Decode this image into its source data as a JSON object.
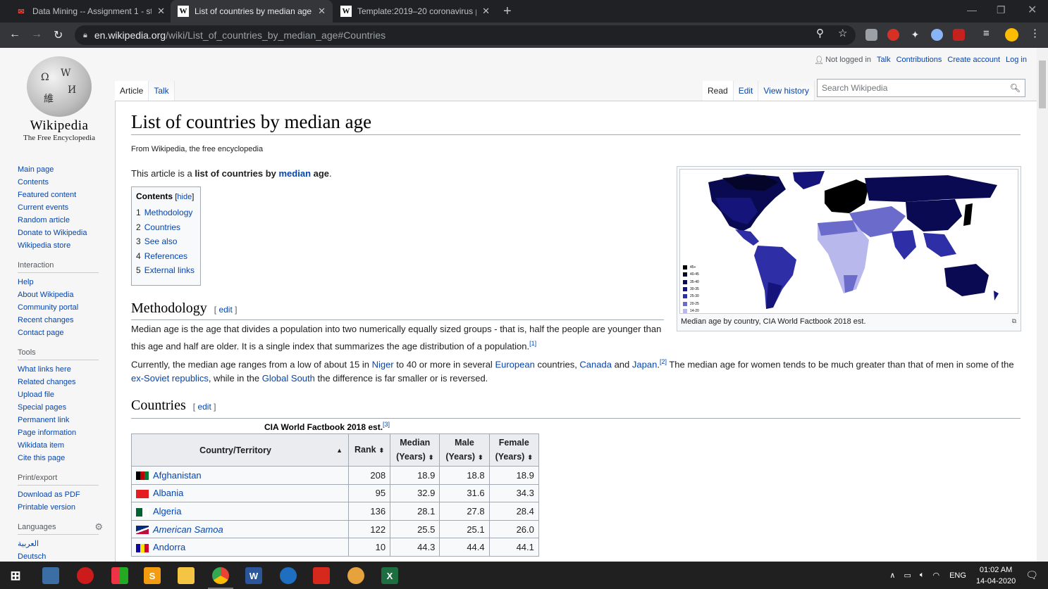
{
  "browser": {
    "tabs": [
      {
        "title": "Data Mining -- Assignment 1 - st",
        "icon": "gmail-icon",
        "active": false
      },
      {
        "title": "List of countries by median age -",
        "icon": "wikipedia-icon",
        "active": true
      },
      {
        "title": "Template:2019–20 coronavirus p",
        "icon": "wikipedia-icon",
        "active": false
      }
    ],
    "url_host": "en.wikipedia.org",
    "url_path": "/wiki/List_of_countries_by_median_age#Countries"
  },
  "wiki": {
    "logo_wordmark": "Wikipedia",
    "logo_tagline": "The Free Encyclopedia",
    "personal": {
      "not_logged_in": "Not logged in",
      "talk": "Talk",
      "contributions": "Contributions",
      "create_account": "Create account",
      "log_in": "Log in"
    },
    "tabs": {
      "article": "Article",
      "talk": "Talk",
      "read": "Read",
      "edit": "Edit",
      "history": "View history"
    },
    "search_placeholder": "Search Wikipedia",
    "sidebar": {
      "navigation": [
        "Main page",
        "Contents",
        "Featured content",
        "Current events",
        "Random article",
        "Donate to Wikipedia",
        "Wikipedia store"
      ],
      "interaction_heading": "Interaction",
      "interaction": [
        "Help",
        "About Wikipedia",
        "Community portal",
        "Recent changes",
        "Contact page"
      ],
      "tools_heading": "Tools",
      "tools": [
        "What links here",
        "Related changes",
        "Upload file",
        "Special pages",
        "Permanent link",
        "Page information",
        "Wikidata item",
        "Cite this page"
      ],
      "print_heading": "Print/export",
      "print": [
        "Download as PDF",
        "Printable version"
      ],
      "languages_heading": "Languages",
      "languages": [
        "العربية",
        "Deutsch"
      ]
    },
    "title": "List of countries by median age",
    "site_sub": "From Wikipedia, the free encyclopedia",
    "intro": {
      "pre": "This article is a ",
      "bold1": "list of countries by ",
      "link": "median",
      "bold2": " age",
      "post": "."
    },
    "toc": {
      "title": "Contents",
      "hide": "hide",
      "items": [
        {
          "num": "1",
          "label": "Methodology"
        },
        {
          "num": "2",
          "label": "Countries"
        },
        {
          "num": "3",
          "label": "See also"
        },
        {
          "num": "4",
          "label": "References"
        },
        {
          "num": "5",
          "label": "External links"
        }
      ]
    },
    "methodology": {
      "heading": "Methodology",
      "edit": "edit",
      "p1a": "Median age is the age that divides a population into two numerically equally sized groups - that is, half the people are younger than",
      "p1b": "this age and half are older. It is a single index that summarizes the age distribution of a population.",
      "p1_ref": "[1]",
      "p2": {
        "t1": "Currently, the median age ranges from a low of about 15 in ",
        "l1": "Niger",
        "t2": " to 40 or more in several ",
        "l2": "European",
        "t3": " countries, ",
        "l3": "Canada",
        "t4": " and ",
        "l4": "Japan",
        "t5": ".",
        "ref": "[2]",
        "t6": " The median age for women tends to be much greater than that of men in some of the",
        "l5": "ex-Soviet republics",
        "t7": ", while in the ",
        "l6": "Global South",
        "t8": " the difference is far smaller or is reversed."
      }
    },
    "map": {
      "caption": "Median age by country, CIA World Factbook 2018 est.",
      "legend": [
        {
          "label": "45+",
          "color": "#000000"
        },
        {
          "label": "40-45",
          "color": "#050529"
        },
        {
          "label": "35-40",
          "color": "#0a0a52"
        },
        {
          "label": "30-35",
          "color": "#14147a"
        },
        {
          "label": "25-30",
          "color": "#2e2ea6"
        },
        {
          "label": "20-25",
          "color": "#6b6bcc"
        },
        {
          "label": "14-20",
          "color": "#b8b8ec"
        }
      ]
    },
    "countries": {
      "heading": "Countries",
      "edit": "edit",
      "caption": "CIA World Factbook 2018 est.",
      "caption_ref": "[3]",
      "headers": {
        "country": "Country/Territory",
        "rank": "Rank",
        "median1": "Median",
        "median2": "(Years)",
        "male1": "Male",
        "male2": "(Years)",
        "female1": "Female",
        "female2": "(Years)"
      },
      "rows": [
        {
          "country": "Afghanistan",
          "rank": "208",
          "median": "18.9",
          "male": "18.8",
          "female": "18.9",
          "italic": false
        },
        {
          "country": "Albania",
          "rank": "95",
          "median": "32.9",
          "male": "31.6",
          "female": "34.3",
          "italic": false
        },
        {
          "country": "Algeria",
          "rank": "136",
          "median": "28.1",
          "male": "27.8",
          "female": "28.4",
          "italic": false
        },
        {
          "country": "American Samoa",
          "rank": "122",
          "median": "25.5",
          "male": "25.1",
          "female": "26.0",
          "italic": true
        },
        {
          "country": "Andorra",
          "rank": "10",
          "median": "44.3",
          "male": "44.4",
          "female": "44.1",
          "italic": false
        }
      ]
    }
  },
  "taskbar": {
    "language": "ENG",
    "time": "01:02 AM",
    "date": "14-04-2020"
  }
}
